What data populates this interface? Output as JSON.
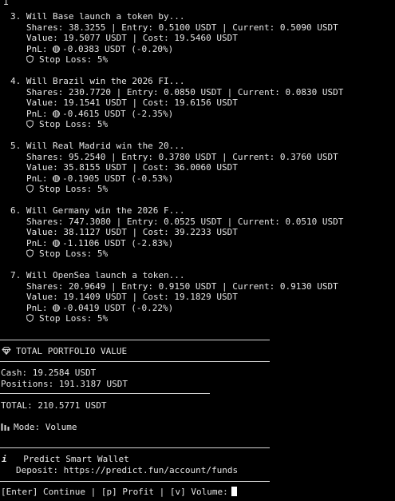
{
  "positions": [
    {
      "header": "3. Will Base launch a token by...",
      "line1": "Shares: 38.3255 | Entry: 0.5100 USDT | Current: 0.5090 USDT",
      "line2": "Value: 19.5077 USDT | Cost: 19.5460 USDT",
      "pnl": "PnL:",
      "pnl_value": "-0.0383 USDT (-0.20%)",
      "stop_loss": "Stop Loss: 5%"
    },
    {
      "header": "4. Will Brazil win the 2026 FI...",
      "line1": "Shares: 230.7720 | Entry: 0.0850 USDT | Current: 0.0830 USDT",
      "line2": "Value: 19.1541 USDT | Cost: 19.6156 USDT",
      "pnl": "PnL:",
      "pnl_value": "-0.4615 USDT (-2.35%)",
      "stop_loss": "Stop Loss: 5%"
    },
    {
      "header": "5. Will Real Madrid win the 20...",
      "line1": "Shares: 95.2540 | Entry: 0.3780 USDT | Current: 0.3760 USDT",
      "line2": "Value: 35.8155 USDT | Cost: 36.0060 USDT",
      "pnl": "PnL:",
      "pnl_value": "-0.1905 USDT (-0.53%)",
      "stop_loss": "Stop Loss: 5%"
    },
    {
      "header": "6. Will Germany win the 2026 F...",
      "line1": "Shares: 747.3080 | Entry: 0.0525 USDT | Current: 0.0510 USDT",
      "line2": "Value: 38.1127 USDT | Cost: 39.2233 USDT",
      "pnl": "PnL:",
      "pnl_value": "-1.1106 USDT (-2.83%)",
      "stop_loss": "Stop Loss: 5%"
    },
    {
      "header": "7. Will OpenSea launch a token...",
      "line1": "Shares: 20.9649 | Entry: 0.9150 USDT | Current: 0.9130 USDT",
      "line2": "Value: 19.1409 USDT | Cost: 19.1829 USDT",
      "pnl": "PnL:",
      "pnl_value": "-0.0419 USDT (-0.22%)",
      "stop_loss": "Stop Loss: 5%"
    }
  ],
  "portfolio": {
    "title": "TOTAL PORTFOLIO VALUE",
    "cash": "Cash: 19.2584 USDT",
    "positions": "Positions: 191.3187 USDT",
    "total": "TOTAL: 210.5771 USDT",
    "mode": "Mode: Volume"
  },
  "wallet": {
    "title": "Predict Smart Wallet",
    "deposit": "Deposit: https://predict.fun/account/funds"
  },
  "prompt": "[Enter] Continue | [p] Profit | [v] Volume:",
  "icons": {
    "pnl": "coin-icon",
    "stop_loss": "shield-icon",
    "portfolio": "diamond-icon",
    "mode": "bar-chart-icon",
    "wallet": "info-icon"
  }
}
